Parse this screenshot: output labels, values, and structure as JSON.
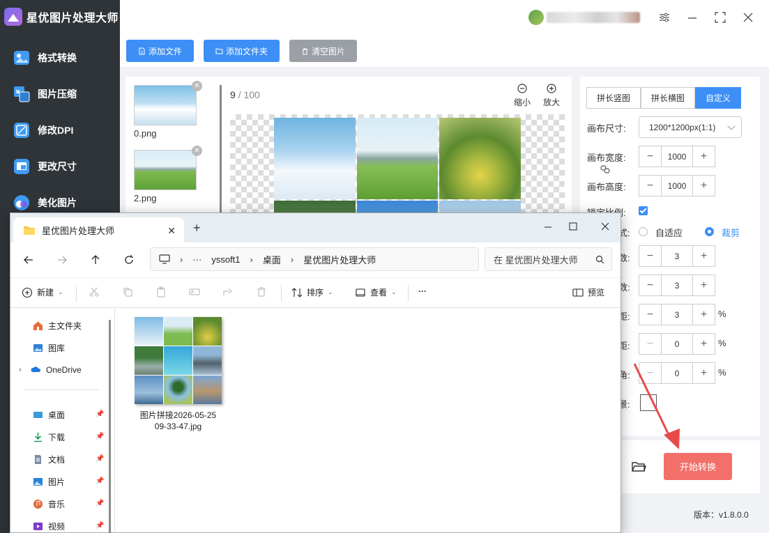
{
  "app": {
    "title": "星优图片处理大师",
    "version": "版本：v1.8.0.0",
    "nav": [
      {
        "label": "格式转换",
        "icon": "image-convert-icon"
      },
      {
        "label": "图片压缩",
        "icon": "image-compress-icon"
      },
      {
        "label": "修改DPI",
        "icon": "dpi-icon"
      },
      {
        "label": "更改尺寸",
        "icon": "resize-icon"
      },
      {
        "label": "美化图片",
        "icon": "beautify-icon"
      }
    ]
  },
  "toolbar": {
    "add_file": "添加文件",
    "add_folder": "添加文件夹",
    "clear_images": "清空图片"
  },
  "files": [
    {
      "name": "0.png"
    },
    {
      "name": "2.png"
    }
  ],
  "preview": {
    "current": "9",
    "total": "100",
    "zoom_out": "缩小",
    "zoom_in": "放大"
  },
  "settings": {
    "modes": [
      "拼长竖图",
      "拼长横图",
      "自定义"
    ],
    "active_mode": "自定义",
    "canvas_size_label": "画布尺寸:",
    "canvas_size_value": "1200*1200px(1:1)",
    "canvas_width_label": "画布宽度:",
    "canvas_width": "1000",
    "canvas_height_label": "画布高度:",
    "canvas_height": "1000",
    "lock_ratio_label": "锁定比例:",
    "fit_label": "式:",
    "fit_options": [
      "自适应",
      "裁剪"
    ],
    "fit_selected": "裁剪",
    "rows_label": "数:",
    "rows": "3",
    "cols_label": "数:",
    "cols": "3",
    "spacing_label": "距:",
    "spacing": "3",
    "margin1_label": "距:",
    "margin1": "0",
    "margin2_label": "角:",
    "margin2": "0",
    "bg_label": "景:",
    "percent": "%",
    "start_button": "开始转换"
  },
  "explorer": {
    "tab_title": "星优图片处理大师",
    "breadcrumb": [
      "yssoft1",
      "桌面",
      "星优图片处理大师"
    ],
    "search_placeholder": "在 星优图片处理大师",
    "commands": {
      "new": "新建",
      "sort": "排序",
      "view": "查看",
      "more": "···",
      "preview": "预览"
    },
    "sidebar": [
      {
        "label": "主文件夹",
        "icon": "home-icon"
      },
      {
        "label": "图库",
        "icon": "gallery-icon"
      },
      {
        "label": "OneDrive",
        "icon": "onedrive-icon"
      },
      {
        "label": "桌面",
        "icon": "desktop-icon"
      },
      {
        "label": "下载",
        "icon": "download-icon"
      },
      {
        "label": "文档",
        "icon": "document-icon"
      },
      {
        "label": "图片",
        "icon": "pictures-icon"
      },
      {
        "label": "音乐",
        "icon": "music-icon"
      },
      {
        "label": "视频",
        "icon": "video-icon"
      }
    ],
    "file": {
      "name_line1": "图片拼接2026-05-25",
      "name_line2": "09-33-47.jpg"
    }
  },
  "colors": {
    "accent": "#3d8ff5",
    "start_button": "#f27069",
    "sidebar_bg": "#2f3439",
    "arrow": "#e84a4a"
  }
}
